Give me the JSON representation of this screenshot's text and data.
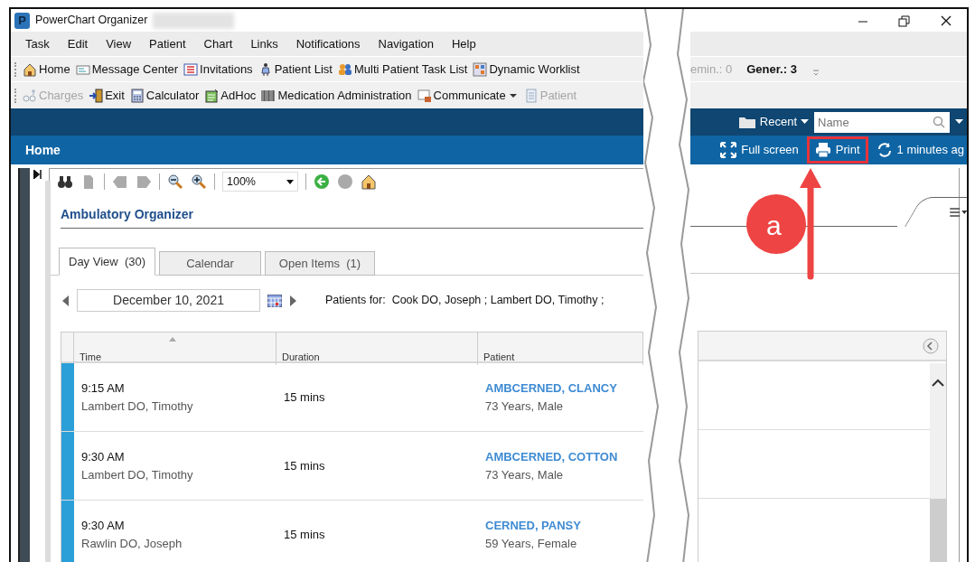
{
  "window": {
    "logo": "P",
    "title": "PowerChart Organizer"
  },
  "menu": [
    "Task",
    "Edit",
    "View",
    "Patient",
    "Chart",
    "Links",
    "Notifications",
    "Navigation",
    "Help"
  ],
  "toolbar_1": [
    {
      "label": "Home",
      "disabled": false
    },
    {
      "label": "Message Center",
      "disabled": false
    },
    {
      "label": "Invitations",
      "disabled": false
    },
    {
      "label": "Patient List",
      "disabled": false
    },
    {
      "label": "Multi Patient Task List",
      "disabled": false
    },
    {
      "label": "Dynamic Worklist",
      "disabled": false
    }
  ],
  "counters": [
    {
      "label": "emin.: 0",
      "disabled": true
    },
    {
      "label": "Gener.: 3",
      "disabled": false
    }
  ],
  "toolbar_2": [
    {
      "label": "Charges",
      "disabled": true,
      "dropdown": false
    },
    {
      "label": "Exit",
      "disabled": false,
      "dropdown": false
    },
    {
      "label": "Calculator",
      "disabled": false,
      "dropdown": false
    },
    {
      "label": "AdHoc",
      "disabled": false,
      "dropdown": false
    },
    {
      "label": "Medication Administration",
      "disabled": false,
      "dropdown": false
    },
    {
      "label": "Communicate",
      "disabled": false,
      "dropdown": true
    },
    {
      "label": "Patient",
      "disabled": true,
      "dropdown": false
    }
  ],
  "header": {
    "recent": "Recent",
    "search": {
      "placeholder": "Name"
    }
  },
  "home_bar": {
    "title": "Home",
    "actions": [
      {
        "label": "Full screen",
        "highlighted": false
      },
      {
        "label": "Print",
        "highlighted": true
      },
      {
        "label": "1 minutes ag",
        "highlighted": false
      }
    ]
  },
  "annotation": {
    "label": "a"
  },
  "organizer": {
    "zoom": "100%",
    "title": "Ambulatory Organizer",
    "tabs": [
      {
        "label": "Day View  (30)",
        "selected": true
      },
      {
        "label": "Calendar",
        "selected": false
      },
      {
        "label": "Open Items  (1)",
        "selected": false
      }
    ],
    "date": "December 10, 2021",
    "patients_for": "Patients for:  Cook DO, Joseph ; Lambert DO, Timothy ;",
    "table": {
      "columns": [
        "Time",
        "Duration",
        "Patient"
      ],
      "rows": [
        {
          "time": "9:15 AM",
          "provider": "Lambert DO, Timothy",
          "duration": "15 mins",
          "patient": "AMBCERNED, CLANCY",
          "details": "73 Years, Male"
        },
        {
          "time": "9:30 AM",
          "provider": "Lambert DO, Timothy",
          "duration": "15 mins",
          "patient": "AMBCERNED, COTTON",
          "details": "73 Years, Male"
        },
        {
          "time": "9:30 AM",
          "provider": "Rawlin DO, Joseph",
          "duration": "15 mins",
          "patient": "CERNED, PANSY",
          "details": "59 Years, Female"
        }
      ]
    }
  }
}
